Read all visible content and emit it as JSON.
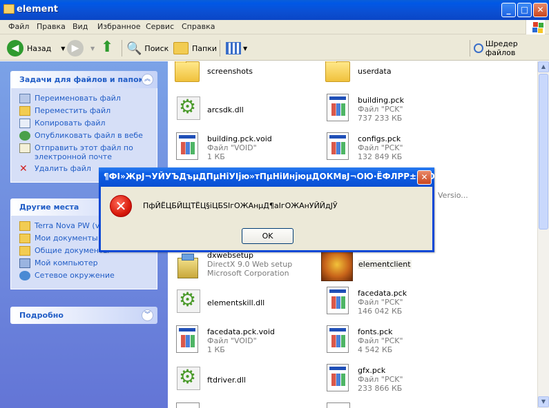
{
  "window": {
    "title": "element"
  },
  "menu": [
    "Файл",
    "Правка",
    "Вид",
    "Избранное",
    "Сервис",
    "Справка"
  ],
  "toolbar": {
    "back_label": "Назад",
    "search_label": "Поиск",
    "folders_label": "Папки",
    "shredder_label": "Шредер файлов"
  },
  "sidebar": {
    "tasks": {
      "title": "Задачи для файлов и папок",
      "items": [
        "Переименовать файл",
        "Переместить файл",
        "Копировать файл",
        "Опубликовать файл в вебе",
        "Отправить этот файл по\nэлектронной почте",
        "Удалить файл"
      ]
    },
    "places": {
      "title": "Другие места",
      "items": [
        "Terra Nova PW (ve",
        "Мои документы",
        "Общие документы",
        "Мой компьютер",
        "Сетевое окружение"
      ]
    },
    "details": {
      "title": "Подробно"
    }
  },
  "files": [
    {
      "name": "screenshots",
      "sub1": "",
      "sub2": "",
      "kind": "folder"
    },
    {
      "name": "userdata",
      "sub1": "",
      "sub2": "",
      "kind": "folder"
    },
    {
      "name": "arcsdk.dll",
      "sub1": "",
      "sub2": "",
      "kind": "dll"
    },
    {
      "name": "building.pck",
      "sub1": "Файл \"PCK\"",
      "sub2": "737 233 КБ",
      "kind": "doc"
    },
    {
      "name": "building.pck.void",
      "sub1": "Файл \"VOID\"",
      "sub2": "1 КБ",
      "kind": "doc"
    },
    {
      "name": "configs.pck",
      "sub1": "Файл \"PCK\"",
      "sub2": "132 849 КБ",
      "kind": "doc"
    },
    {
      "name": "dxwebsetup",
      "sub1": "DirectX 9.0 Web setup",
      "sub2": "Microsoft Corporation",
      "kind": "setup"
    },
    {
      "name": "elementclient",
      "sub1": "",
      "sub2": "",
      "kind": "app"
    },
    {
      "name": "elementskill.dll",
      "sub1": "",
      "sub2": "",
      "kind": "dll"
    },
    {
      "name": "facedata.pck",
      "sub1": "Файл \"PCK\"",
      "sub2": "146 042 КБ",
      "kind": "doc"
    },
    {
      "name": "facedata.pck.void",
      "sub1": "Файл \"VOID\"",
      "sub2": "1 КБ",
      "kind": "doc"
    },
    {
      "name": "fonts.pck",
      "sub1": "Файл \"PCK\"",
      "sub2": "4 542 КБ",
      "kind": "doc"
    },
    {
      "name": "ftdriver.dll",
      "sub1": "",
      "sub2": "",
      "kind": "dll"
    },
    {
      "name": "gfx.pck",
      "sub1": "Файл \"PCK\"",
      "sub2": "233 866 КБ",
      "kind": "doc"
    }
  ],
  "hidden_partial_text": "Versio...",
  "dialog": {
    "title": "¶ФІ»ЖрЈ¬УЙУЪДъµДПµНіУІјю»тПµНіИнјюµДОКМвЈ¬ОЮ·ЁФЛРР±sУОП·!",
    "message": "ПфЙЁЦБЙЩТЁЦ§іЦБSІгОЖАнµД¶аІгОЖАнУЙЙдЈЎ",
    "ok_label": "OK"
  }
}
